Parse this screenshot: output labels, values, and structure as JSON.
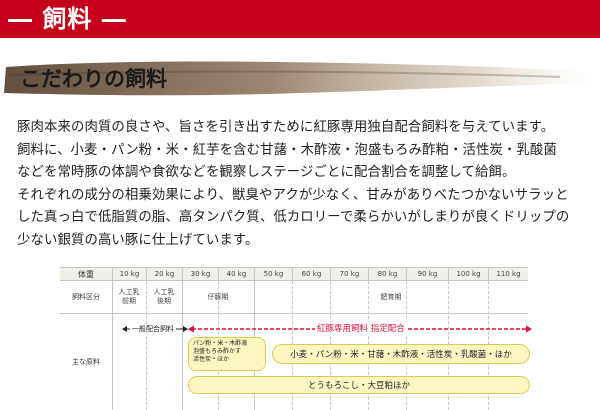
{
  "header": {
    "title": "― 飼料 ―",
    "accent_color": "#c4001a"
  },
  "section": {
    "title": "こだわりの飼料"
  },
  "body": {
    "lines": [
      "豚肉本来の肉質の良さや、旨さを引き出すために紅豚専用独自配合飼料を与えています。",
      "飼料に、小麦・パン粉・米・紅芋を含む甘藷・木酢液・泡盛もろみ酢粕・活性炭・乳酸菌",
      "などを常時豚の体調や食欲などを観察しステージごとに配合割合を調整して給餌。",
      "それぞれの成分の相乗効果により、獣臭やアクが少なく、甘みがありべたつかないサラッと",
      "した真っ白で低脂質の脂、高タンパク質、低カロリーで柔らかいがしまりが良くドリップの",
      "少ない銀質の高い豚に仕上げています。"
    ]
  },
  "table": {
    "weight_label": "体重",
    "weights": [
      "10 kg",
      "20 kg",
      "30 kg",
      "40 kg",
      "50 kg",
      "60 kg",
      "70 kg",
      "80 kg",
      "90 kg",
      "100 kg",
      "110 kg"
    ],
    "category_label": "飼料区分",
    "categories": {
      "early": "人工乳\n前期",
      "late": "人工乳\n後期",
      "piglet": "仔豚期",
      "fattening": "肥育期"
    },
    "main_label": "主な原料",
    "general_feed": "一般配合飼料",
    "special_feed": "紅豚専用飼料  指定配合",
    "piglet_ingredients": "パン粉・米・木酢液\n泡盛もろみ酢かす\n活性炭・ほか",
    "fattening_ingredients": "小麦・パン粉・米・甘藷・木酢液・活性炭・乳酸菌・ほか",
    "base_ingredients": "とうもろこし・大豆粕ほか"
  }
}
